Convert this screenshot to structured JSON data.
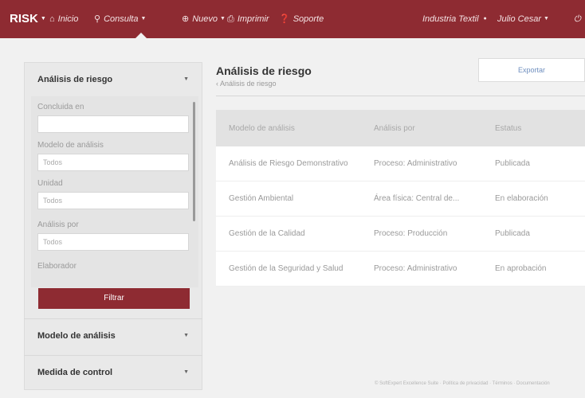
{
  "topbar": {
    "brand": "RISK",
    "nav": [
      {
        "label": "Inicio",
        "icon": "home-icon"
      },
      {
        "label": "Consulta",
        "icon": "search-icon"
      },
      {
        "label": "Nuevo",
        "icon": "plus-icon"
      },
      {
        "label": "Imprimir",
        "icon": "print-icon"
      },
      {
        "label": "Soporte",
        "icon": "help-icon"
      }
    ],
    "company": "Industria Textil",
    "user": "Julio Cesar",
    "accent_color": "#8e2b32"
  },
  "sidebar": {
    "section_title": "Análisis de riesgo",
    "filters": [
      {
        "label": "Concluida en",
        "value": ""
      },
      {
        "label": "Modelo de análisis",
        "value": "Todos"
      },
      {
        "label": "Unidad",
        "value": "Todos"
      },
      {
        "label": "Análisis por",
        "value": "Todos"
      },
      {
        "label": "Elaborador",
        "value": ""
      }
    ],
    "filter_button": "Filtrar",
    "sections": [
      {
        "label": "Modelo de análisis"
      },
      {
        "label": "Medida de control"
      }
    ]
  },
  "main": {
    "title": "Análisis de riesgo",
    "breadcrumb": "‹ Análisis de riesgo",
    "export_button": "Exportar",
    "table": {
      "columns": [
        "Modelo de análisis",
        "Análisis por",
        "Estatus"
      ],
      "rows": [
        [
          "Análisis de Riesgo Demonstrativo",
          "Proceso: Administrativo",
          "Publicada"
        ],
        [
          "Gestión Ambiental",
          "Área física: Central de...",
          "En elaboración"
        ],
        [
          "Gestión de la Calidad",
          "Proceso: Producción",
          "Publicada"
        ],
        [
          "Gestión de la Seguridad y Salud",
          "Proceso: Administrativo",
          "En aprobación"
        ]
      ]
    }
  },
  "footer": {
    "text": "© SoftExpert Excellence Suite · Política de privacidad · Términos · Documentación"
  }
}
